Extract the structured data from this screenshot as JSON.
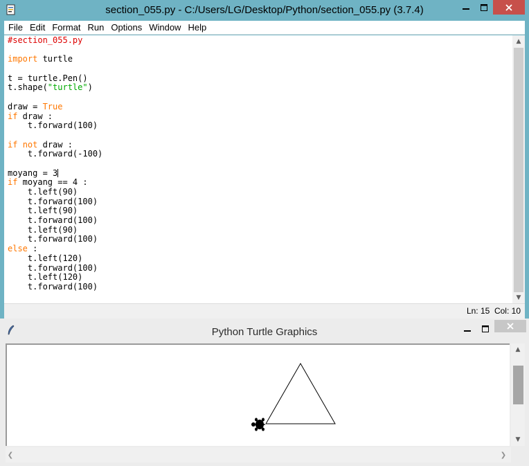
{
  "idle": {
    "title": "section_055.py - C:/Users/LG/Desktop/Python/section_055.py (3.7.4)",
    "menu": [
      "File",
      "Edit",
      "Format",
      "Run",
      "Options",
      "Window",
      "Help"
    ],
    "status": "Ln: 15  Col: 10"
  },
  "code_lines": [
    [
      {
        "t": "#section_055.py",
        "c": "comment"
      }
    ],
    [],
    [
      {
        "t": "import",
        "c": "kw"
      },
      {
        "t": " turtle"
      }
    ],
    [],
    [
      {
        "t": "t = turtle.Pen()"
      }
    ],
    [
      {
        "t": "t.shape("
      },
      {
        "t": "\"turtle\"",
        "c": "str"
      },
      {
        "t": ")"
      }
    ],
    [],
    [
      {
        "t": "draw = "
      },
      {
        "t": "True",
        "c": "kw"
      }
    ],
    [
      {
        "t": "if",
        "c": "kw"
      },
      {
        "t": " draw :"
      }
    ],
    [
      {
        "t": "    t.forward(100)"
      }
    ],
    [],
    [
      {
        "t": "if",
        "c": "kw"
      },
      {
        "t": " "
      },
      {
        "t": "not",
        "c": "kw"
      },
      {
        "t": " draw :"
      }
    ],
    [
      {
        "t": "    t.forward(-100)"
      }
    ],
    [],
    [
      {
        "t": "moyang = 3"
      },
      {
        "cursor": true
      }
    ],
    [
      {
        "t": "if",
        "c": "kw"
      },
      {
        "t": " moyang == 4 :"
      }
    ],
    [
      {
        "t": "    t.left(90)"
      }
    ],
    [
      {
        "t": "    t.forward(100)"
      }
    ],
    [
      {
        "t": "    t.left(90)"
      }
    ],
    [
      {
        "t": "    t.forward(100)"
      }
    ],
    [
      {
        "t": "    t.left(90)"
      }
    ],
    [
      {
        "t": "    t.forward(100)"
      }
    ],
    [
      {
        "t": "else",
        "c": "kw"
      },
      {
        "t": " :"
      }
    ],
    [
      {
        "t": "    t.left(120)"
      }
    ],
    [
      {
        "t": "    t.forward(100)"
      }
    ],
    [
      {
        "t": "    t.left(120)"
      }
    ],
    [
      {
        "t": "    t.forward(100)"
      }
    ]
  ],
  "turtle": {
    "title": "Python Turtle Graphics",
    "pen_color": "#000000",
    "turtle_icon": "turtle-shape-icon"
  },
  "colors": {
    "comment": "#dd0000",
    "keyword": "#ff7700",
    "string": "#00aa00",
    "window_frame": "#6fb3c4",
    "close_button": "#c7504b"
  },
  "icons": [
    "idle-app-icon",
    "minimize-icon",
    "maximize-icon",
    "close-icon",
    "feather-icon",
    "chevron-up-icon",
    "chevron-down-icon",
    "chevron-left-icon",
    "chevron-right-icon"
  ]
}
